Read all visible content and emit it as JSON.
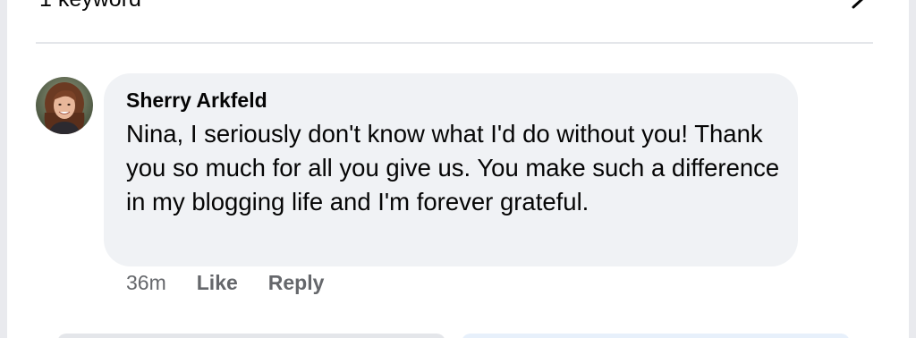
{
  "settings_row": {
    "label": "1 keyword",
    "icon": "chevron-right-icon"
  },
  "comment": {
    "author": "Sherry Arkfeld",
    "avatar": "user-avatar",
    "text": "Nina, I seriously don't know what I'd do without you! Thank you so much for all you give us. You make such a difference in my blogging life and I'm forever grateful.",
    "timestamp": "36m",
    "like_label": "Like",
    "reply_label": "Reply"
  },
  "colors": {
    "bubble_bg": "#f0f2f5",
    "text": "#050505",
    "meta_text": "#65676b",
    "divider": "#e4e6ea"
  }
}
